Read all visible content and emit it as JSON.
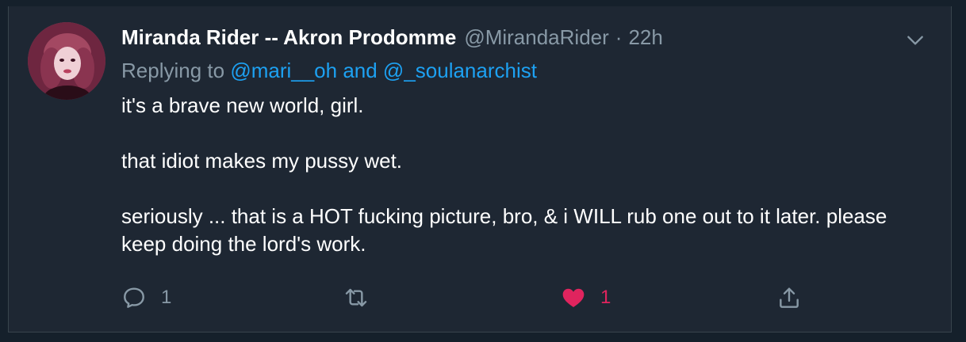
{
  "tweet": {
    "author_name": "Miranda Rider -- Akron Prodomme",
    "author_handle": "@MirandaRider",
    "separator": "·",
    "time": "22h",
    "replying_prefix": "Replying to",
    "replying_users": "@mari__oh and @_soulanarchist",
    "body_lines": [
      "it's a brave new world, girl.",
      "",
      "that idiot makes my pussy wet.",
      "",
      "seriously ...  that is a HOT fucking picture, bro, & i WILL rub one out to it later.  please keep doing the lord's work."
    ],
    "reply_count": "1",
    "retweet_count": "",
    "like_count": "1"
  },
  "icons": {
    "reply": "reply-icon",
    "retweet": "retweet-icon",
    "like": "heart-icon",
    "share": "share-icon",
    "menu": "chevron-down-icon"
  },
  "colors": {
    "background": "#15202b",
    "card": "#1e2733",
    "text": "#ffffff",
    "muted": "#8899a6",
    "link": "#1da1f2",
    "like": "#e0245e"
  }
}
